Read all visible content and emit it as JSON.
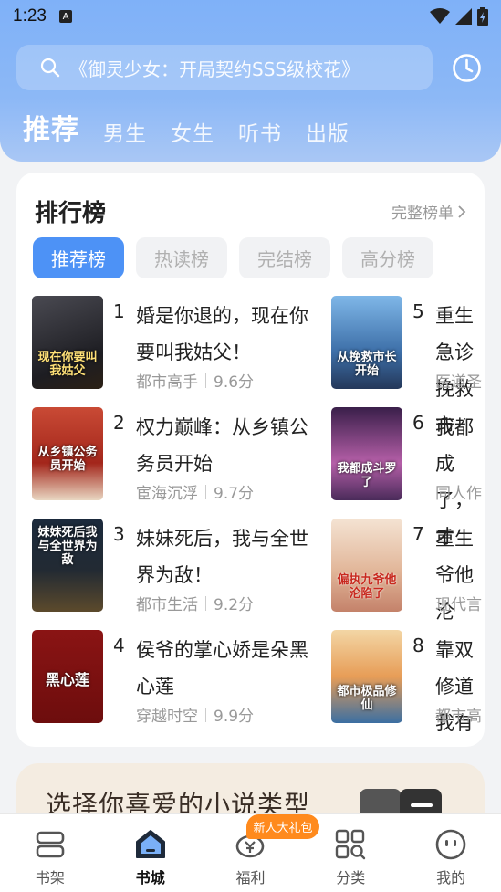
{
  "status": {
    "time": "1:23",
    "notif_letter": "A"
  },
  "search": {
    "placeholder": "《御灵少女：开局契约SSS级校花》"
  },
  "tabs": [
    "推荐",
    "男生",
    "女生",
    "听书",
    "出版"
  ],
  "ranking": {
    "title": "排行榜",
    "more": "完整榜单",
    "pills": [
      "推荐榜",
      "热读榜",
      "完结榜",
      "高分榜"
    ],
    "books": [
      {
        "rank": "1",
        "title": "婚是你退的，现在你要叫我姑父！",
        "genre": "都市高手",
        "score": "9.6分",
        "cover_text": "现在你要叫我姑父"
      },
      {
        "rank": "2",
        "title": "权力巅峰：从乡镇公务员开始",
        "genre": "宦海沉浮",
        "score": "9.7分",
        "cover_text": "从乡镇公务员开始"
      },
      {
        "rank": "3",
        "title": "妹妹死后，我与全世界为敌！",
        "genre": "都市生活",
        "score": "9.2分",
        "cover_text": "妹妹死后我与全世界为敌"
      },
      {
        "rank": "4",
        "title": "侯爷的掌心娇是朵黑心莲",
        "genre": "穿越时空",
        "score": "9.9分",
        "cover_text": "黑心莲"
      },
      {
        "rank": "5",
        "title": "重生急诊挽救市",
        "genre": "医道圣",
        "score": "",
        "cover_text": "从挽救市长开始"
      },
      {
        "rank": "6",
        "title": "我都成了，才",
        "genre": "同人作",
        "score": "",
        "cover_text": "我都成斗罗了"
      },
      {
        "rank": "7",
        "title": "重生爷他沦",
        "genre": "现代言",
        "score": "",
        "cover_text": "偏执九爷他沦陷了"
      },
      {
        "rank": "8",
        "title": "靠双修道我有",
        "genre": "都市高",
        "score": "",
        "cover_text": "都市极品修仙"
      }
    ]
  },
  "promo": {
    "text": "选择你喜爱的小说类型"
  },
  "nav": {
    "items": [
      "书架",
      "书城",
      "福利",
      "分类",
      "我的"
    ],
    "badge": "新人大礼包"
  },
  "colors": {
    "accent": "#4d92f6",
    "header": "#8cb8f6",
    "badge": "#ff8a1d"
  }
}
